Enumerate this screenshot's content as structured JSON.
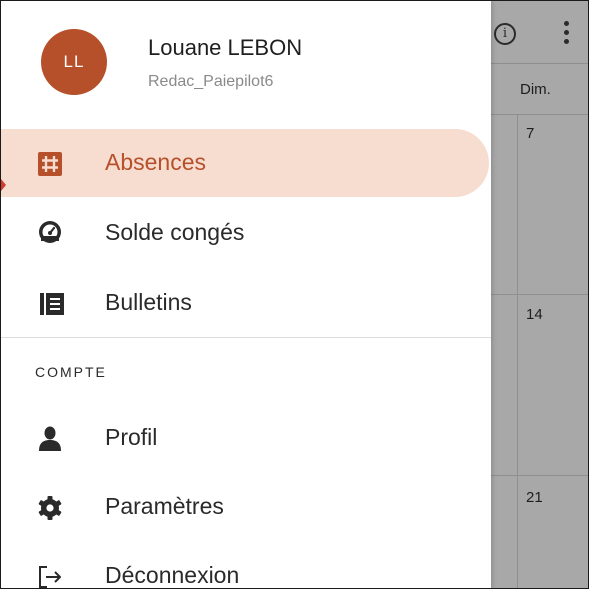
{
  "user": {
    "initials": "LL",
    "name": "Louane LEBON",
    "login": "Redac_Paiepilot6"
  },
  "menu": {
    "items": [
      {
        "label": "Absences",
        "icon": "hash-grid-icon",
        "active": true
      },
      {
        "label": "Solde congés",
        "icon": "gauge-icon",
        "active": false
      },
      {
        "label": "Bulletins",
        "icon": "document-list-icon",
        "active": false
      }
    ],
    "section_title": "COMPTE",
    "account_items": [
      {
        "label": "Profil",
        "icon": "person-icon"
      },
      {
        "label": "Paramètres",
        "icon": "gear-icon"
      },
      {
        "label": "Déconnexion",
        "icon": "logout-icon"
      }
    ]
  },
  "calendar": {
    "info_glyph": "i",
    "day_header": "Dim.",
    "dates": [
      "7",
      "14",
      "21"
    ]
  },
  "colors": {
    "accent": "#b6502a",
    "active_bg": "#f7dcd0",
    "overlay": "#a8a8a8"
  }
}
